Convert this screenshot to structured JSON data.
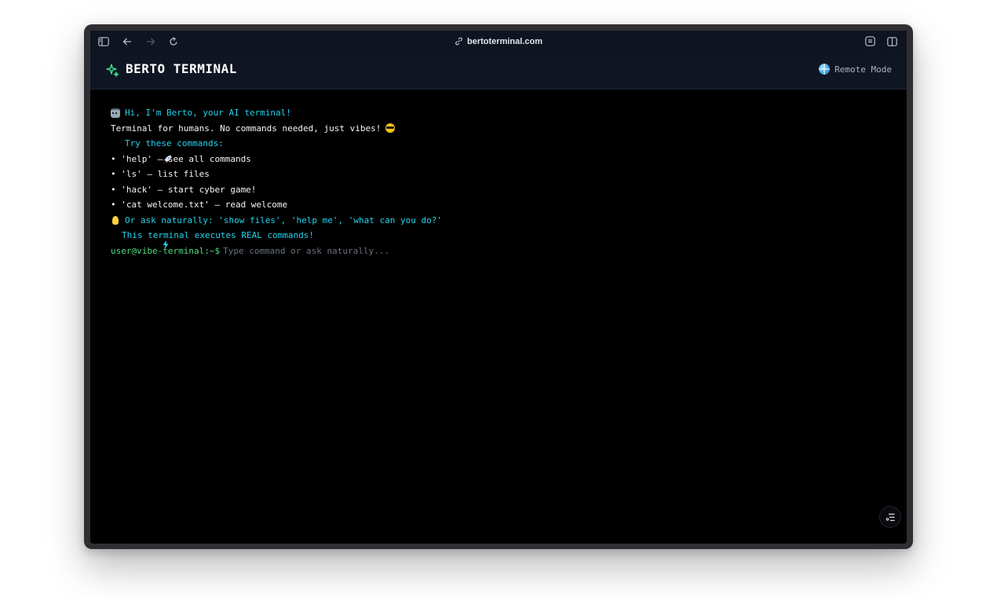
{
  "browser": {
    "url": "bertoterminal.com"
  },
  "header": {
    "title": "BERTO TERMINAL",
    "mode_label": "Remote Mode"
  },
  "terminal": {
    "lines": [
      {
        "text": "Hi, I'm Berto, your AI terminal!",
        "color": "cyan",
        "icon": "robot-icon"
      },
      {
        "text": "Terminal for humans. No commands needed, just vibes!",
        "color": "white",
        "icon_after": "sunglasses-icon"
      },
      {
        "text": "Try these commands:",
        "color": "cyan",
        "icon": "rocket-icon"
      },
      {
        "text": "• 'help' – see all commands",
        "color": "white"
      },
      {
        "text": "• 'ls' – list files",
        "color": "white"
      },
      {
        "text": "• 'hack' – start cyber game!",
        "color": "white"
      },
      {
        "text": "• 'cat welcome.txt' – read welcome",
        "color": "white"
      },
      {
        "text": "Or ask naturally: 'show files', 'help me', 'what can you do?'",
        "color": "cyan",
        "icon": "lightbulb-icon"
      },
      {
        "text": "This terminal executes REAL commands!",
        "color": "cyan",
        "icon": "lightning-icon"
      }
    ],
    "prompt": "user@vibe-terminal:~$",
    "input_value": "",
    "input_placeholder": "Type command or ask naturally..."
  },
  "colors": {
    "accent_cyan": "#22d3ee",
    "prompt_green": "#4ade80",
    "brand_green": "#39d98a",
    "header_bg": "#0f1522",
    "terminal_bg": "#000000"
  }
}
